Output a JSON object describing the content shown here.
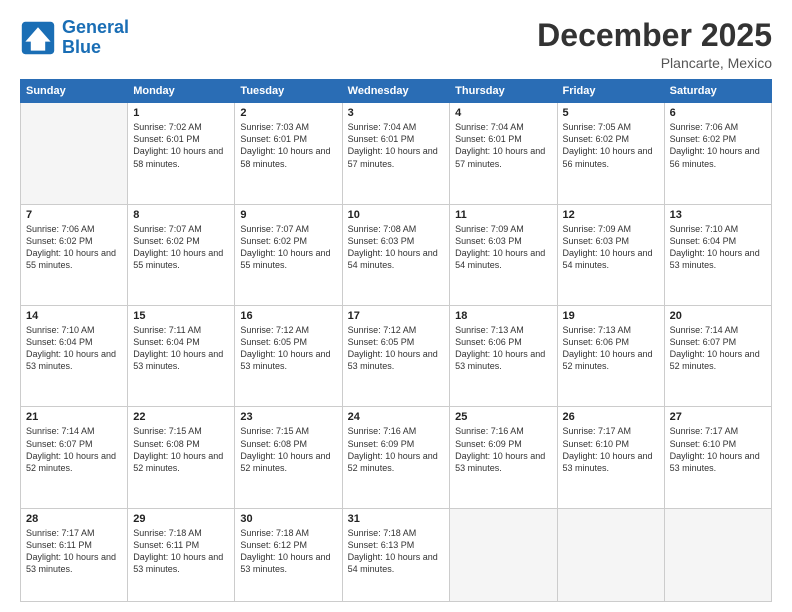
{
  "logo": {
    "line1": "General",
    "line2": "Blue"
  },
  "title": "December 2025",
  "subtitle": "Plancarte, Mexico",
  "headers": [
    "Sunday",
    "Monday",
    "Tuesday",
    "Wednesday",
    "Thursday",
    "Friday",
    "Saturday"
  ],
  "weeks": [
    [
      {
        "day": "",
        "sunrise": "",
        "sunset": "",
        "daylight": ""
      },
      {
        "day": "1",
        "sunrise": "7:02 AM",
        "sunset": "6:01 PM",
        "daylight": "10 hours and 58 minutes."
      },
      {
        "day": "2",
        "sunrise": "7:03 AM",
        "sunset": "6:01 PM",
        "daylight": "10 hours and 58 minutes."
      },
      {
        "day": "3",
        "sunrise": "7:04 AM",
        "sunset": "6:01 PM",
        "daylight": "10 hours and 57 minutes."
      },
      {
        "day": "4",
        "sunrise": "7:04 AM",
        "sunset": "6:01 PM",
        "daylight": "10 hours and 57 minutes."
      },
      {
        "day": "5",
        "sunrise": "7:05 AM",
        "sunset": "6:02 PM",
        "daylight": "10 hours and 56 minutes."
      },
      {
        "day": "6",
        "sunrise": "7:06 AM",
        "sunset": "6:02 PM",
        "daylight": "10 hours and 56 minutes."
      }
    ],
    [
      {
        "day": "7",
        "sunrise": "7:06 AM",
        "sunset": "6:02 PM",
        "daylight": "10 hours and 55 minutes."
      },
      {
        "day": "8",
        "sunrise": "7:07 AM",
        "sunset": "6:02 PM",
        "daylight": "10 hours and 55 minutes."
      },
      {
        "day": "9",
        "sunrise": "7:07 AM",
        "sunset": "6:02 PM",
        "daylight": "10 hours and 55 minutes."
      },
      {
        "day": "10",
        "sunrise": "7:08 AM",
        "sunset": "6:03 PM",
        "daylight": "10 hours and 54 minutes."
      },
      {
        "day": "11",
        "sunrise": "7:09 AM",
        "sunset": "6:03 PM",
        "daylight": "10 hours and 54 minutes."
      },
      {
        "day": "12",
        "sunrise": "7:09 AM",
        "sunset": "6:03 PM",
        "daylight": "10 hours and 54 minutes."
      },
      {
        "day": "13",
        "sunrise": "7:10 AM",
        "sunset": "6:04 PM",
        "daylight": "10 hours and 53 minutes."
      }
    ],
    [
      {
        "day": "14",
        "sunrise": "7:10 AM",
        "sunset": "6:04 PM",
        "daylight": "10 hours and 53 minutes."
      },
      {
        "day": "15",
        "sunrise": "7:11 AM",
        "sunset": "6:04 PM",
        "daylight": "10 hours and 53 minutes."
      },
      {
        "day": "16",
        "sunrise": "7:12 AM",
        "sunset": "6:05 PM",
        "daylight": "10 hours and 53 minutes."
      },
      {
        "day": "17",
        "sunrise": "7:12 AM",
        "sunset": "6:05 PM",
        "daylight": "10 hours and 53 minutes."
      },
      {
        "day": "18",
        "sunrise": "7:13 AM",
        "sunset": "6:06 PM",
        "daylight": "10 hours and 53 minutes."
      },
      {
        "day": "19",
        "sunrise": "7:13 AM",
        "sunset": "6:06 PM",
        "daylight": "10 hours and 52 minutes."
      },
      {
        "day": "20",
        "sunrise": "7:14 AM",
        "sunset": "6:07 PM",
        "daylight": "10 hours and 52 minutes."
      }
    ],
    [
      {
        "day": "21",
        "sunrise": "7:14 AM",
        "sunset": "6:07 PM",
        "daylight": "10 hours and 52 minutes."
      },
      {
        "day": "22",
        "sunrise": "7:15 AM",
        "sunset": "6:08 PM",
        "daylight": "10 hours and 52 minutes."
      },
      {
        "day": "23",
        "sunrise": "7:15 AM",
        "sunset": "6:08 PM",
        "daylight": "10 hours and 52 minutes."
      },
      {
        "day": "24",
        "sunrise": "7:16 AM",
        "sunset": "6:09 PM",
        "daylight": "10 hours and 52 minutes."
      },
      {
        "day": "25",
        "sunrise": "7:16 AM",
        "sunset": "6:09 PM",
        "daylight": "10 hours and 53 minutes."
      },
      {
        "day": "26",
        "sunrise": "7:17 AM",
        "sunset": "6:10 PM",
        "daylight": "10 hours and 53 minutes."
      },
      {
        "day": "27",
        "sunrise": "7:17 AM",
        "sunset": "6:10 PM",
        "daylight": "10 hours and 53 minutes."
      }
    ],
    [
      {
        "day": "28",
        "sunrise": "7:17 AM",
        "sunset": "6:11 PM",
        "daylight": "10 hours and 53 minutes."
      },
      {
        "day": "29",
        "sunrise": "7:18 AM",
        "sunset": "6:11 PM",
        "daylight": "10 hours and 53 minutes."
      },
      {
        "day": "30",
        "sunrise": "7:18 AM",
        "sunset": "6:12 PM",
        "daylight": "10 hours and 53 minutes."
      },
      {
        "day": "31",
        "sunrise": "7:18 AM",
        "sunset": "6:13 PM",
        "daylight": "10 hours and 54 minutes."
      },
      {
        "day": "",
        "sunrise": "",
        "sunset": "",
        "daylight": ""
      },
      {
        "day": "",
        "sunrise": "",
        "sunset": "",
        "daylight": ""
      },
      {
        "day": "",
        "sunrise": "",
        "sunset": "",
        "daylight": ""
      }
    ]
  ]
}
